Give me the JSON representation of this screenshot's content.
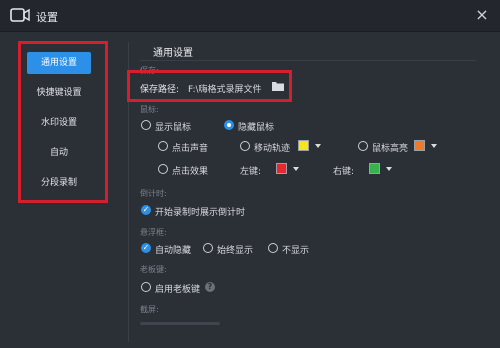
{
  "window": {
    "title": "设置",
    "close": "×"
  },
  "sidebar": {
    "items": [
      {
        "label": "通用设置"
      },
      {
        "label": "快捷键设置"
      },
      {
        "label": "水印设置"
      },
      {
        "label": "自动"
      },
      {
        "label": "分段录制"
      }
    ]
  },
  "content": {
    "section_title": "通用设置",
    "save": {
      "group_label": "保存:",
      "label": "保存路径:",
      "value": "F:\\嗨格式录屏文件"
    },
    "mouse": {
      "group_label": "鼠标:",
      "show_cursor": "显示鼠标",
      "hide_cursor": "隐藏鼠标",
      "click_sound": "点击声音",
      "move_track": "移动轨迹",
      "cursor_highlight": "鼠标高亮",
      "click_effect": "点击效果",
      "left_key": "左键:",
      "right_key": "右键:"
    },
    "countdown": {
      "group_label": "倒计时:",
      "option": "开始录制时展示倒计时"
    },
    "float": {
      "group_label": "悬浮框:",
      "auto_hide": "自动隐藏",
      "always_show": "始终显示",
      "no_show": "不显示"
    },
    "boss_key": {
      "group_label": "老板键:",
      "enable": "启用老板键",
      "help": "?"
    },
    "screenshot": {
      "group_label": "截屏:"
    }
  },
  "colors": {
    "accent": "#2c8fe8",
    "highlight_box": "#d41f2d",
    "track_color": "#f5e61c",
    "highlight_color": "#f07a2a",
    "left_key_color": "#e8282d",
    "right_key_color": "#38b24a"
  },
  "icons": {
    "app": "video-camera-icon",
    "folder": "folder-icon",
    "dropdown": "chevron-down-icon"
  }
}
